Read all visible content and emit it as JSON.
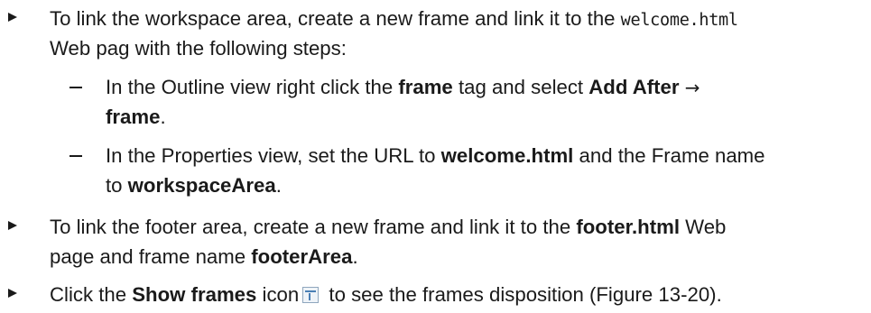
{
  "items": [
    {
      "line1": {
        "t1": "To link the workspace area, create a new frame and link it to the ",
        "code": "welcome.html"
      },
      "line2": "Web pag with the following steps:",
      "sub": [
        {
          "line1": {
            "t1": "In the Outline view right click the ",
            "b1": "frame",
            "t2": " tag and select ",
            "b2": "Add After",
            "arrow": "→"
          },
          "line2": {
            "b1": "frame",
            "t1": "."
          }
        },
        {
          "line1": {
            "t1": "In the Properties view, set the URL to ",
            "b1": "welcome.html",
            "t2": " and the Frame name"
          },
          "line2": {
            "t1": "to ",
            "b1": "workspaceArea",
            "t2": "."
          }
        }
      ]
    },
    {
      "line1": {
        "t1": "To link the footer area, create a new frame and link it to the ",
        "b1": "footer.html",
        "t2": " Web"
      },
      "line2": {
        "t1": "page and frame name ",
        "b1": "footerArea",
        "t2": "."
      }
    },
    {
      "line1": {
        "t1": "Click the ",
        "b1": "Show frames",
        "t2": " icon",
        "icon": "show-frames-icon",
        "t3": " to see the frames disposition (Figure 13-20)."
      }
    }
  ]
}
